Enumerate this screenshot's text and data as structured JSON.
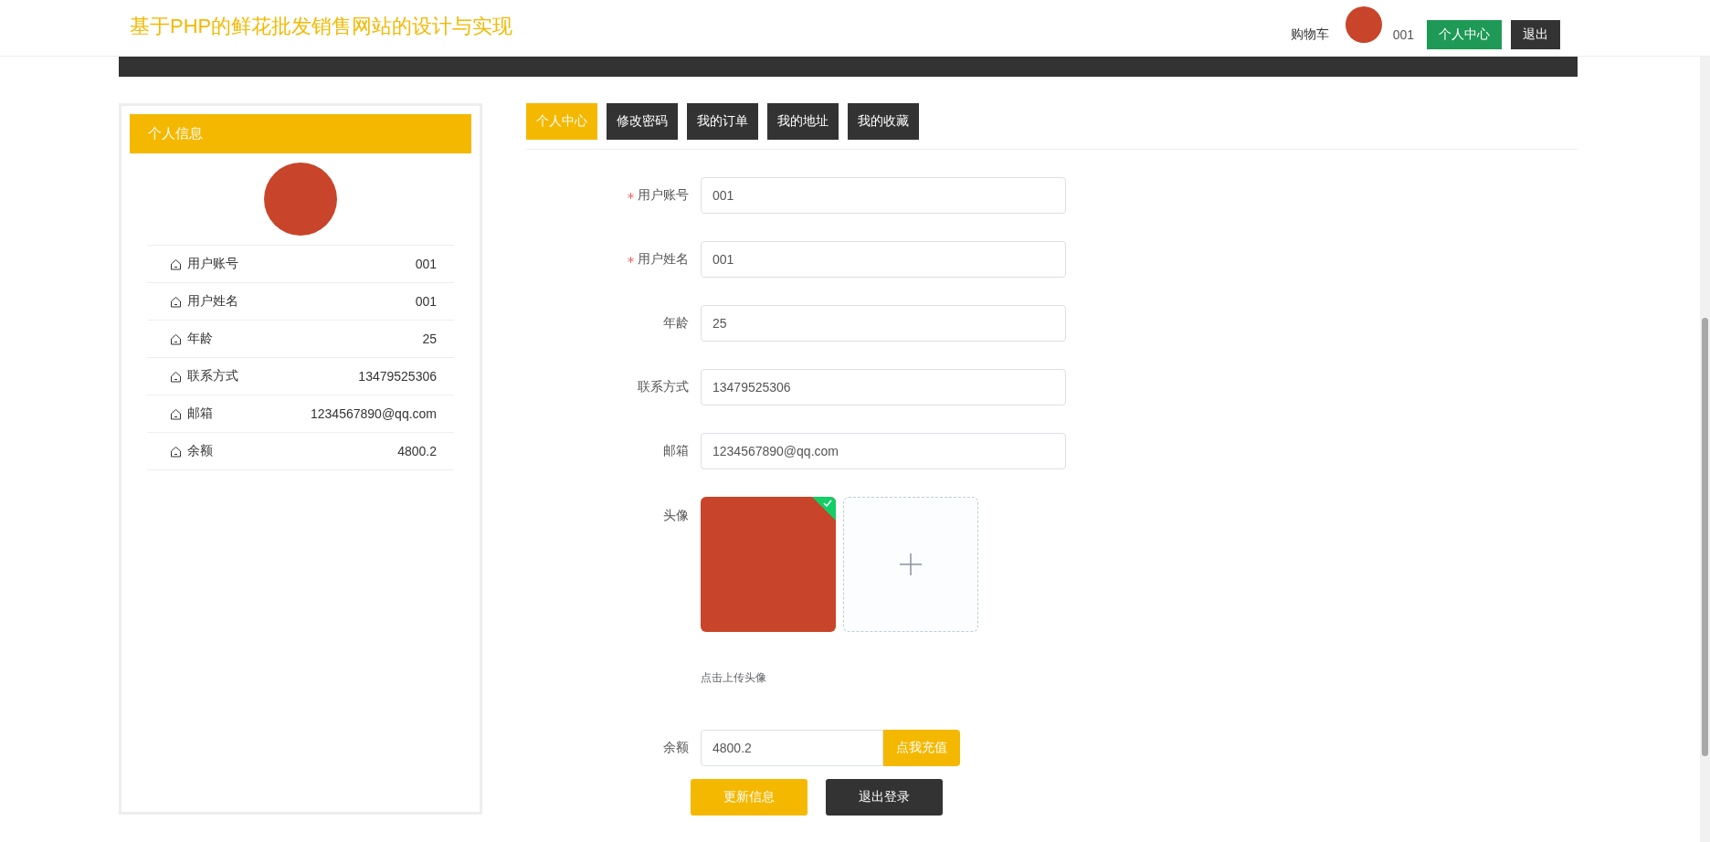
{
  "header": {
    "title": "基于PHP的鲜花批发销售网站的设计与实现",
    "cart_link": "购物车",
    "username": "001",
    "buttons": [
      {
        "label": "个人中心",
        "kind": "primary"
      },
      {
        "label": "退出",
        "kind": "dark"
      }
    ]
  },
  "sidebar": {
    "title": "个人信息",
    "rows": [
      {
        "label": "用户账号",
        "value": "001"
      },
      {
        "label": "用户姓名",
        "value": "001"
      },
      {
        "label": "年龄",
        "value": "25"
      },
      {
        "label": "联系方式",
        "value": "13479525306"
      },
      {
        "label": "邮箱",
        "value": "1234567890@qq.com"
      },
      {
        "label": "余额",
        "value": "4800.2"
      }
    ]
  },
  "tabs": [
    {
      "label": "个人中心",
      "selected": true
    },
    {
      "label": "修改密码",
      "selected": false
    },
    {
      "label": "我的订单",
      "selected": false
    },
    {
      "label": "我的地址",
      "selected": false
    },
    {
      "label": "我的收藏",
      "selected": false
    }
  ],
  "form": {
    "fields": [
      {
        "label": "用户账号",
        "value": "001",
        "required": true
      },
      {
        "label": "用户姓名",
        "value": "001",
        "required": true
      },
      {
        "label": "年龄",
        "value": "25",
        "required": false
      },
      {
        "label": "联系方式",
        "value": "13479525306",
        "required": false
      },
      {
        "label": "邮箱",
        "value": "1234567890@qq.com",
        "required": false
      }
    ],
    "avatar": {
      "label": "头像",
      "hint": "点击上传头像"
    },
    "balance": {
      "label": "余额",
      "value": "4800.2",
      "button": "点我充值"
    },
    "actions": [
      {
        "label": "更新信息",
        "kind": "primary"
      },
      {
        "label": "退出登录",
        "kind": "dark"
      }
    ]
  }
}
